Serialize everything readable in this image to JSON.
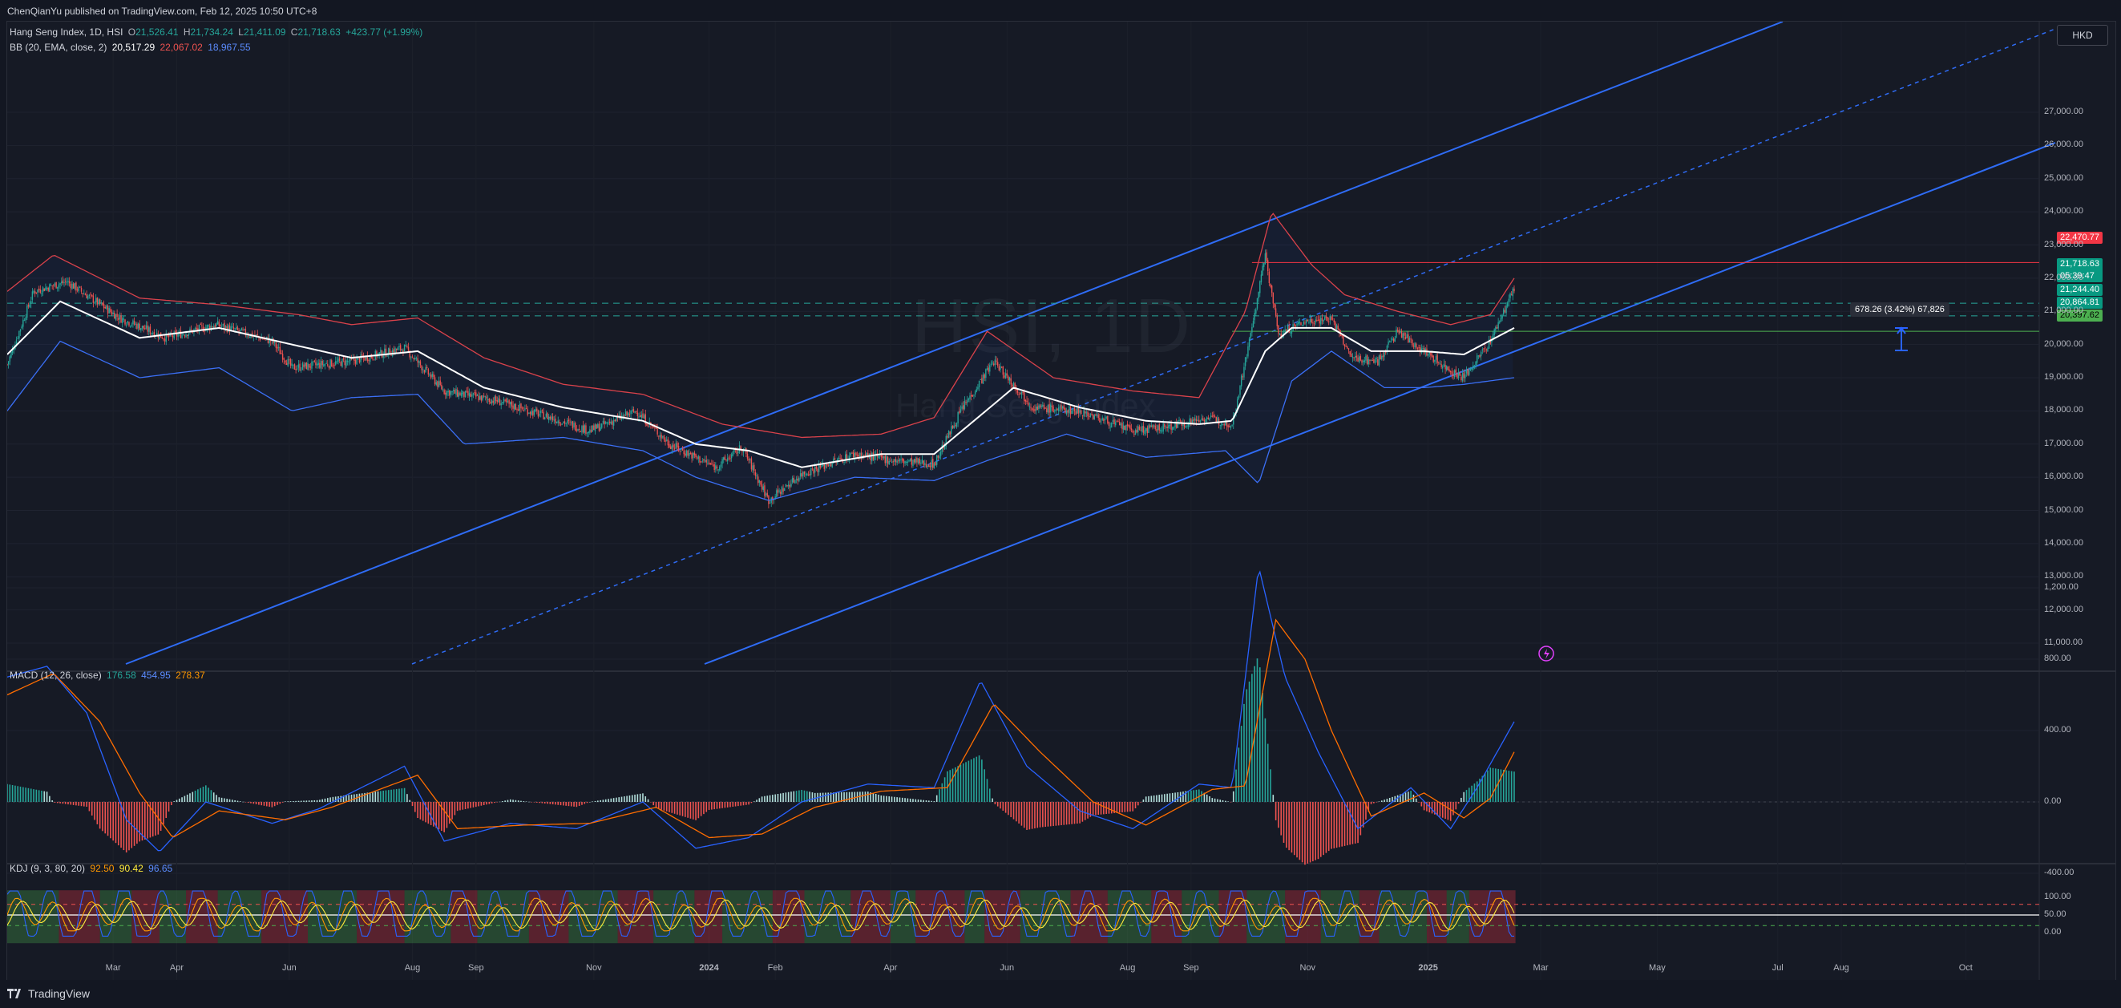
{
  "publisher_line": "ChenQianYu published on TradingView.com, Feb 12, 2025 10:50 UTC+8",
  "symbol_legend": {
    "name": "Hang Seng Index, 1D, HSI",
    "o_label": "O",
    "o_value": "21,526.41",
    "h_label": "H",
    "h_value": "21,734.24",
    "l_label": "L",
    "l_value": "21,411.09",
    "c_label": "C",
    "c_value": "21,718.63",
    "change": "+423.77 (+1.99%)"
  },
  "bb_legend": {
    "label": "BB (20, EMA, close, 2)",
    "basis": "20,517.29",
    "upper": "22,067.02",
    "lower": "18,967.55"
  },
  "macd_legend": {
    "label": "MACD (12, 26, close)",
    "hist": "176.58",
    "macd": "454.95",
    "signal": "278.37"
  },
  "kdj_legend": {
    "label": "KDJ (9, 3, 80, 20)",
    "k": "92.50",
    "d": "90.42",
    "j": "96.65"
  },
  "watermark": {
    "symbol": "HSI, 1D",
    "name": "Hang Seng Index"
  },
  "currency_button": "HKD",
  "measure_label": "678.26 (3.42%) 67,826",
  "price_labels": {
    "resistance": "22,470.77",
    "last_price": "21,718.63",
    "countdown": "05:39:47",
    "bb_upper_hi": "21,244.40",
    "bb_mid": "20,864.81",
    "support": "20,397.62"
  },
  "colors": {
    "background": "#161a25",
    "up": "#26a69a",
    "down": "#ef5350",
    "bb_upper": "#d9424b",
    "bb_lower": "#3b6ff5",
    "bb_basis": "#ffffff",
    "channel": "#2f6cf6",
    "macd": "#2962ff",
    "signal": "#ff6d00",
    "k": "#ff9800",
    "d": "#ffeb3b",
    "j": "#2962ff"
  },
  "footer_brand": "TradingView",
  "chart_data": {
    "type": "candlestick",
    "main": {
      "y_ticks": [
        "27,000.00",
        "26,000.00",
        "25,000.00",
        "24,000.00",
        "23,000.00",
        "22,000.00",
        "21,000.00",
        "20,000.00",
        "19,000.00",
        "18,000.00",
        "17,000.00",
        "16,000.00",
        "15,000.00",
        "14,000.00",
        "13,000.00",
        "12,000.00",
        "11,000.00"
      ],
      "ylim": [
        10500,
        28300
      ],
      "close_path": [
        {
          "x": 0,
          "y": 19400
        },
        {
          "x": 20,
          "y": 21600
        },
        {
          "x": 45,
          "y": 21900
        },
        {
          "x": 85,
          "y": 20800
        },
        {
          "x": 120,
          "y": 20200
        },
        {
          "x": 158,
          "y": 20600
        },
        {
          "x": 200,
          "y": 20100
        },
        {
          "x": 215,
          "y": 19300
        },
        {
          "x": 260,
          "y": 19500
        },
        {
          "x": 300,
          "y": 19900
        },
        {
          "x": 330,
          "y": 18600
        },
        {
          "x": 370,
          "y": 18300
        },
        {
          "x": 410,
          "y": 17800
        },
        {
          "x": 440,
          "y": 17400
        },
        {
          "x": 475,
          "y": 18000
        },
        {
          "x": 500,
          "y": 17000
        },
        {
          "x": 535,
          "y": 16300
        },
        {
          "x": 555,
          "y": 16900
        },
        {
          "x": 575,
          "y": 15300
        },
        {
          "x": 600,
          "y": 16100
        },
        {
          "x": 640,
          "y": 16700
        },
        {
          "x": 670,
          "y": 16500
        },
        {
          "x": 700,
          "y": 16400
        },
        {
          "x": 720,
          "y": 18000
        },
        {
          "x": 745,
          "y": 19500
        },
        {
          "x": 775,
          "y": 18100
        },
        {
          "x": 810,
          "y": 18000
        },
        {
          "x": 850,
          "y": 17400
        },
        {
          "x": 875,
          "y": 17500
        },
        {
          "x": 905,
          "y": 17800
        },
        {
          "x": 925,
          "y": 17600
        },
        {
          "x": 940,
          "y": 20500
        },
        {
          "x": 950,
          "y": 22700
        },
        {
          "x": 960,
          "y": 20300
        },
        {
          "x": 980,
          "y": 20700
        },
        {
          "x": 1000,
          "y": 20800
        },
        {
          "x": 1015,
          "y": 19600
        },
        {
          "x": 1035,
          "y": 19500
        },
        {
          "x": 1050,
          "y": 20400
        },
        {
          "x": 1070,
          "y": 19800
        },
        {
          "x": 1090,
          "y": 19200
        },
        {
          "x": 1100,
          "y": 19000
        },
        {
          "x": 1120,
          "y": 20100
        },
        {
          "x": 1138,
          "y": 21700
        }
      ],
      "bb_upper_path": [
        {
          "x": 0,
          "y": 21600
        },
        {
          "x": 35,
          "y": 22700
        },
        {
          "x": 100,
          "y": 21400
        },
        {
          "x": 160,
          "y": 21200
        },
        {
          "x": 220,
          "y": 20900
        },
        {
          "x": 260,
          "y": 20600
        },
        {
          "x": 310,
          "y": 20800
        },
        {
          "x": 360,
          "y": 19600
        },
        {
          "x": 420,
          "y": 18800
        },
        {
          "x": 480,
          "y": 18500
        },
        {
          "x": 540,
          "y": 17600
        },
        {
          "x": 600,
          "y": 17200
        },
        {
          "x": 660,
          "y": 17300
        },
        {
          "x": 700,
          "y": 17800
        },
        {
          "x": 740,
          "y": 20400
        },
        {
          "x": 790,
          "y": 19000
        },
        {
          "x": 850,
          "y": 18600
        },
        {
          "x": 900,
          "y": 18400
        },
        {
          "x": 935,
          "y": 21000
        },
        {
          "x": 955,
          "y": 24000
        },
        {
          "x": 985,
          "y": 22400
        },
        {
          "x": 1010,
          "y": 21500
        },
        {
          "x": 1050,
          "y": 21000
        },
        {
          "x": 1090,
          "y": 20600
        },
        {
          "x": 1120,
          "y": 20900
        },
        {
          "x": 1138,
          "y": 22000
        }
      ],
      "bb_basis_path": [
        {
          "x": 0,
          "y": 19700
        },
        {
          "x": 40,
          "y": 21300
        },
        {
          "x": 100,
          "y": 20200
        },
        {
          "x": 160,
          "y": 20500
        },
        {
          "x": 215,
          "y": 20000
        },
        {
          "x": 260,
          "y": 19600
        },
        {
          "x": 310,
          "y": 19800
        },
        {
          "x": 360,
          "y": 18700
        },
        {
          "x": 420,
          "y": 18100
        },
        {
          "x": 480,
          "y": 17700
        },
        {
          "x": 520,
          "y": 17000
        },
        {
          "x": 560,
          "y": 16800
        },
        {
          "x": 600,
          "y": 16300
        },
        {
          "x": 660,
          "y": 16700
        },
        {
          "x": 700,
          "y": 16700
        },
        {
          "x": 760,
          "y": 18700
        },
        {
          "x": 810,
          "y": 18100
        },
        {
          "x": 860,
          "y": 17700
        },
        {
          "x": 900,
          "y": 17600
        },
        {
          "x": 925,
          "y": 17700
        },
        {
          "x": 950,
          "y": 19800
        },
        {
          "x": 970,
          "y": 20500
        },
        {
          "x": 1000,
          "y": 20500
        },
        {
          "x": 1030,
          "y": 19800
        },
        {
          "x": 1070,
          "y": 19800
        },
        {
          "x": 1100,
          "y": 19700
        },
        {
          "x": 1138,
          "y": 20500
        }
      ],
      "bb_lower_path": [
        {
          "x": 0,
          "y": 18000
        },
        {
          "x": 40,
          "y": 20100
        },
        {
          "x": 100,
          "y": 19000
        },
        {
          "x": 160,
          "y": 19300
        },
        {
          "x": 215,
          "y": 18000
        },
        {
          "x": 260,
          "y": 18400
        },
        {
          "x": 310,
          "y": 18500
        },
        {
          "x": 345,
          "y": 17000
        },
        {
          "x": 420,
          "y": 17200
        },
        {
          "x": 480,
          "y": 16800
        },
        {
          "x": 520,
          "y": 16000
        },
        {
          "x": 575,
          "y": 15300
        },
        {
          "x": 640,
          "y": 16000
        },
        {
          "x": 700,
          "y": 15900
        },
        {
          "x": 740,
          "y": 16500
        },
        {
          "x": 800,
          "y": 17300
        },
        {
          "x": 860,
          "y": 16600
        },
        {
          "x": 920,
          "y": 16800
        },
        {
          "x": 945,
          "y": 15800
        },
        {
          "x": 970,
          "y": 18900
        },
        {
          "x": 1000,
          "y": 19800
        },
        {
          "x": 1040,
          "y": 18700
        },
        {
          "x": 1070,
          "y": 18700
        },
        {
          "x": 1100,
          "y": 18800
        },
        {
          "x": 1138,
          "y": 19000
        }
      ],
      "levels": [
        {
          "name": "resistance",
          "value": 22470.77
        },
        {
          "name": "dashed-upper",
          "value": 21244.4
        },
        {
          "name": "dashed-mid",
          "value": 20864.81
        },
        {
          "name": "support",
          "value": 20397.62
        }
      ]
    },
    "macd": {
      "y_ticks": [
        "1,200.00",
        "800.00",
        "400.00",
        "0.00",
        "-400.00"
      ],
      "ylim": [
        -600,
        1300
      ],
      "macd_path": [
        {
          "x": 0,
          "y": 700
        },
        {
          "x": 30,
          "y": 760
        },
        {
          "x": 60,
          "y": 500
        },
        {
          "x": 90,
          "y": -100
        },
        {
          "x": 115,
          "y": -280
        },
        {
          "x": 150,
          "y": 0
        },
        {
          "x": 200,
          "y": -120
        },
        {
          "x": 235,
          "y": -40
        },
        {
          "x": 300,
          "y": 200
        },
        {
          "x": 330,
          "y": -220
        },
        {
          "x": 380,
          "y": -120
        },
        {
          "x": 430,
          "y": -150
        },
        {
          "x": 480,
          "y": 0
        },
        {
          "x": 520,
          "y": -260
        },
        {
          "x": 560,
          "y": -200
        },
        {
          "x": 600,
          "y": 0
        },
        {
          "x": 650,
          "y": 100
        },
        {
          "x": 700,
          "y": 80
        },
        {
          "x": 735,
          "y": 680
        },
        {
          "x": 770,
          "y": 200
        },
        {
          "x": 810,
          "y": -50
        },
        {
          "x": 850,
          "y": -150
        },
        {
          "x": 900,
          "y": 100
        },
        {
          "x": 925,
          "y": 80
        },
        {
          "x": 945,
          "y": 1320
        },
        {
          "x": 965,
          "y": 700
        },
        {
          "x": 990,
          "y": 280
        },
        {
          "x": 1020,
          "y": -150
        },
        {
          "x": 1060,
          "y": 80
        },
        {
          "x": 1090,
          "y": -150
        },
        {
          "x": 1110,
          "y": 80
        },
        {
          "x": 1138,
          "y": 450
        }
      ],
      "signal_path": [
        {
          "x": 0,
          "y": 600
        },
        {
          "x": 35,
          "y": 720
        },
        {
          "x": 70,
          "y": 450
        },
        {
          "x": 100,
          "y": 50
        },
        {
          "x": 125,
          "y": -200
        },
        {
          "x": 160,
          "y": -50
        },
        {
          "x": 210,
          "y": -100
        },
        {
          "x": 245,
          "y": -30
        },
        {
          "x": 310,
          "y": 150
        },
        {
          "x": 340,
          "y": -150
        },
        {
          "x": 390,
          "y": -130
        },
        {
          "x": 440,
          "y": -120
        },
        {
          "x": 490,
          "y": -30
        },
        {
          "x": 530,
          "y": -200
        },
        {
          "x": 570,
          "y": -180
        },
        {
          "x": 610,
          "y": -30
        },
        {
          "x": 660,
          "y": 60
        },
        {
          "x": 710,
          "y": 80
        },
        {
          "x": 745,
          "y": 550
        },
        {
          "x": 780,
          "y": 280
        },
        {
          "x": 820,
          "y": 0
        },
        {
          "x": 860,
          "y": -130
        },
        {
          "x": 910,
          "y": 70
        },
        {
          "x": 935,
          "y": 90
        },
        {
          "x": 958,
          "y": 1020
        },
        {
          "x": 980,
          "y": 800
        },
        {
          "x": 1000,
          "y": 400
        },
        {
          "x": 1030,
          "y": -80
        },
        {
          "x": 1070,
          "y": 50
        },
        {
          "x": 1100,
          "y": -90
        },
        {
          "x": 1120,
          "y": 20
        },
        {
          "x": 1138,
          "y": 280
        }
      ]
    },
    "kdj": {
      "y_ticks": [
        "100.00",
        "50.00",
        "0.00"
      ],
      "ylim": [
        -20,
        140
      ],
      "overbought": 80,
      "midline": 50,
      "oversold": 20
    },
    "x_ticks": [
      {
        "label": "Mar",
        "x": 80
      },
      {
        "label": "Apr",
        "x": 128
      },
      {
        "label": "Jun",
        "x": 213
      },
      {
        "label": "Aug",
        "x": 306
      },
      {
        "label": "Sep",
        "x": 354
      },
      {
        "label": "Nov",
        "x": 443
      },
      {
        "label": "2024",
        "x": 530
      },
      {
        "label": "Feb",
        "x": 580
      },
      {
        "label": "Apr",
        "x": 667
      },
      {
        "label": "Jun",
        "x": 755
      },
      {
        "label": "Aug",
        "x": 846
      },
      {
        "label": "Sep",
        "x": 894
      },
      {
        "label": "Nov",
        "x": 982
      },
      {
        "label": "2025",
        "x": 1073
      },
      {
        "label": "Mar",
        "x": 1158
      },
      {
        "label": "May",
        "x": 1246
      },
      {
        "label": "Jul",
        "x": 1337
      },
      {
        "label": "Aug",
        "x": 1385
      },
      {
        "label": "Oct",
        "x": 1479
      }
    ]
  }
}
